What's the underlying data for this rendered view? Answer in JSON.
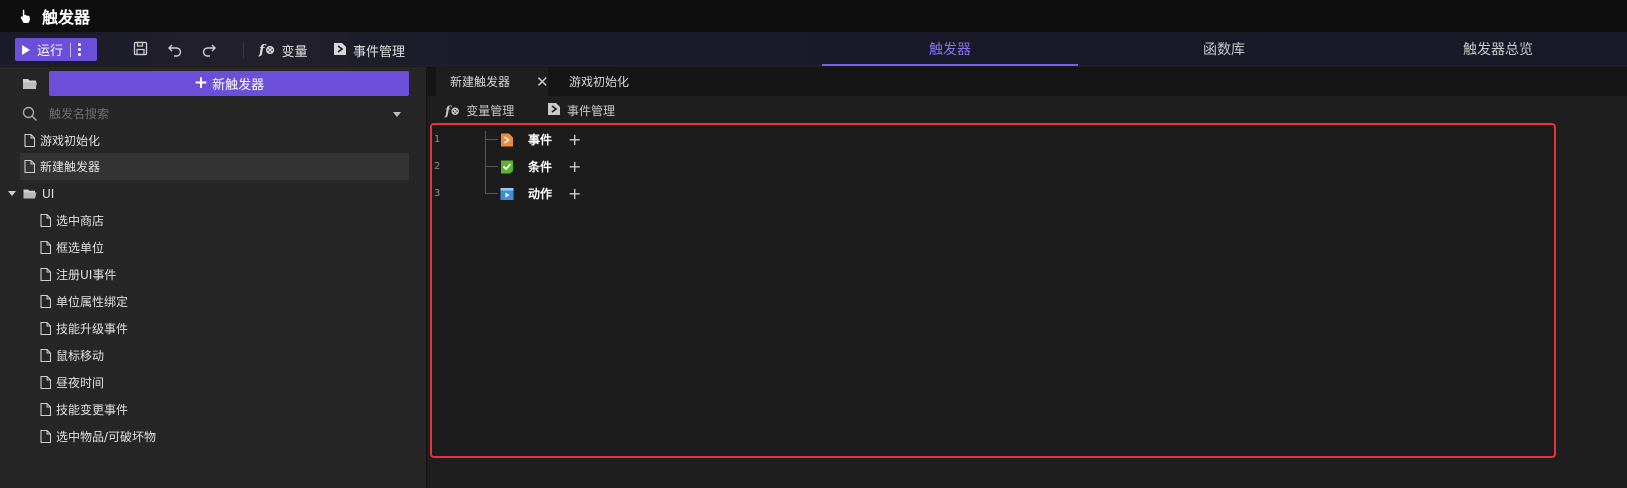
{
  "app": {
    "title": "触发器",
    "icon": "pointing-hand-icon"
  },
  "toolbar": {
    "run_label": "运行",
    "variables_label": "变量",
    "events_label": "事件管理",
    "icons": [
      "play-icon",
      "more-vertical-icon",
      "save-icon",
      "undo-icon",
      "redo-icon",
      "function-icon",
      "event-manage-icon"
    ]
  },
  "nav_tabs": [
    {
      "label": "触发器",
      "active": true
    },
    {
      "label": "函数库",
      "active": false
    },
    {
      "label": "触发器总览",
      "active": false
    }
  ],
  "sidebar": {
    "new_trigger_label": "新触发器",
    "search_placeholder": "触发名搜索",
    "items": [
      {
        "label": "游戏初始化"
      },
      {
        "label": "新建触发器",
        "selected": true
      }
    ],
    "folder": {
      "label": "UI",
      "expanded": true,
      "children": [
        "选中商店",
        "框选单位",
        "注册UI事件",
        "单位属性绑定",
        "技能升级事件",
        "鼠标移动",
        "昼夜时间",
        "技能变更事件",
        "选中物品/可破坏物"
      ]
    }
  },
  "editor_tabs": [
    {
      "label": "新建触发器",
      "active": true,
      "closable": true
    },
    {
      "label": "游戏初始化",
      "active": false
    }
  ],
  "editor_toolbar": {
    "variables_label": "变量管理",
    "events_label": "事件管理"
  },
  "trigger_nodes": [
    {
      "line": "1",
      "label": "事件",
      "icon": "event-icon",
      "color": "#f08a3c"
    },
    {
      "line": "2",
      "label": "条件",
      "icon": "condition-icon",
      "color": "#5ab52a"
    },
    {
      "line": "3",
      "label": "动作",
      "icon": "action-icon",
      "color": "#3d8fd8"
    }
  ],
  "colors": {
    "accent": "#6b4fd8",
    "highlight_border": "#e8323c"
  }
}
